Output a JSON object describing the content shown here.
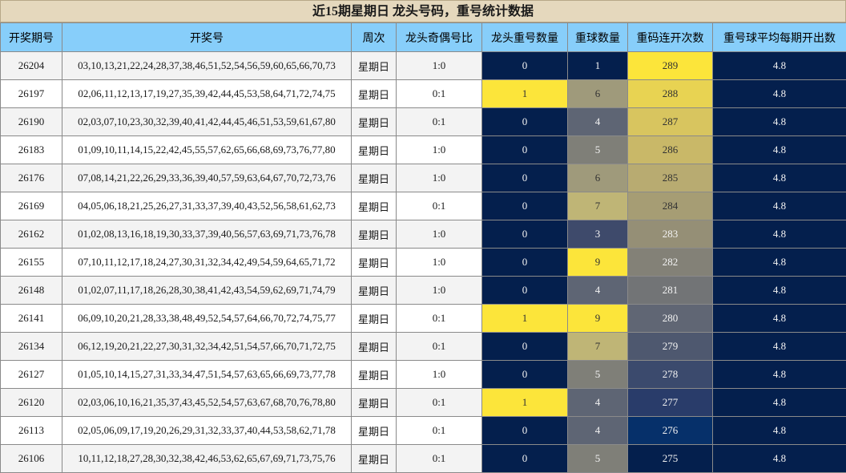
{
  "title": "近15期星期日 龙头号码，重号统计数据",
  "headers": [
    "开奖期号",
    "开奖号",
    "周次",
    "龙头奇偶号比",
    "龙头重号数量",
    "重球数量",
    "重码连开次数",
    "重号球平均每期开出数"
  ],
  "colors": {
    "header_bg": "#87cefa",
    "title_bg": "#e5d8bd",
    "navy": "#041f4d",
    "yellow": "#fce53a"
  },
  "rows": [
    {
      "period": "26204",
      "numbers": "03,10,13,21,22,24,28,37,38,46,51,52,54,56,59,60,65,66,70,73",
      "weekday": "星期日",
      "odd_even": "1:0",
      "head_repeat": "0",
      "repeat_balls": "1",
      "repeat_streak": "289",
      "avg": "4.8",
      "bg_head": "#041f4d",
      "bg_balls": "#041f4d",
      "bg_streak": "#fce53a"
    },
    {
      "period": "26197",
      "numbers": "02,06,11,12,13,17,19,27,35,39,42,44,45,53,58,64,71,72,74,75",
      "weekday": "星期日",
      "odd_even": "0:1",
      "head_repeat": "1",
      "repeat_balls": "6",
      "repeat_streak": "288",
      "avg": "4.8",
      "bg_head": "#fce53a",
      "bg_balls": "#9f9a7b",
      "bg_streak": "#e8d352"
    },
    {
      "period": "26190",
      "numbers": "02,03,07,10,23,30,32,39,40,41,42,44,45,46,51,53,59,61,67,80",
      "weekday": "星期日",
      "odd_even": "0:1",
      "head_repeat": "0",
      "repeat_balls": "4",
      "repeat_streak": "287",
      "avg": "4.8",
      "bg_head": "#041f4d",
      "bg_balls": "#5e6574",
      "bg_streak": "#d8c55f"
    },
    {
      "period": "26183",
      "numbers": "01,09,10,11,14,15,22,42,45,55,57,62,65,66,68,69,73,76,77,80",
      "weekday": "星期日",
      "odd_even": "1:0",
      "head_repeat": "0",
      "repeat_balls": "5",
      "repeat_streak": "286",
      "avg": "4.8",
      "bg_head": "#041f4d",
      "bg_balls": "#7f7f78",
      "bg_streak": "#c9b868"
    },
    {
      "period": "26176",
      "numbers": "07,08,14,21,22,26,29,33,36,39,40,57,59,63,64,67,70,72,73,76",
      "weekday": "星期日",
      "odd_even": "1:0",
      "head_repeat": "0",
      "repeat_balls": "6",
      "repeat_streak": "285",
      "avg": "4.8",
      "bg_head": "#041f4d",
      "bg_balls": "#9f9a7b",
      "bg_streak": "#b8ab71"
    },
    {
      "period": "26169",
      "numbers": "04,05,06,18,21,25,26,27,31,33,37,39,40,43,52,56,58,61,62,73",
      "weekday": "星期日",
      "odd_even": "0:1",
      "head_repeat": "0",
      "repeat_balls": "7",
      "repeat_streak": "284",
      "avg": "4.8",
      "bg_head": "#041f4d",
      "bg_balls": "#bfb576",
      "bg_streak": "#a69d74"
    },
    {
      "period": "26162",
      "numbers": "01,02,08,13,16,18,19,30,33,37,39,40,56,57,63,69,71,73,76,78",
      "weekday": "星期日",
      "odd_even": "1:0",
      "head_repeat": "0",
      "repeat_balls": "3",
      "repeat_streak": "283",
      "avg": "4.8",
      "bg_head": "#041f4d",
      "bg_balls": "#3e4a6b",
      "bg_streak": "#958f76"
    },
    {
      "period": "26155",
      "numbers": "07,10,11,12,17,18,24,27,30,31,32,34,42,49,54,59,64,65,71,72",
      "weekday": "星期日",
      "odd_even": "1:0",
      "head_repeat": "0",
      "repeat_balls": "9",
      "repeat_streak": "282",
      "avg": "4.8",
      "bg_head": "#041f4d",
      "bg_balls": "#fce53a",
      "bg_streak": "#838177"
    },
    {
      "period": "26148",
      "numbers": "01,02,07,11,17,18,26,28,30,38,41,42,43,54,59,62,69,71,74,79",
      "weekday": "星期日",
      "odd_even": "1:0",
      "head_repeat": "0",
      "repeat_balls": "4",
      "repeat_streak": "281",
      "avg": "4.8",
      "bg_head": "#041f4d",
      "bg_balls": "#5e6574",
      "bg_streak": "#727476"
    },
    {
      "period": "26141",
      "numbers": "06,09,10,20,21,28,33,38,48,49,52,54,57,64,66,70,72,74,75,77",
      "weekday": "星期日",
      "odd_even": "0:1",
      "head_repeat": "1",
      "repeat_balls": "9",
      "repeat_streak": "280",
      "avg": "4.8",
      "bg_head": "#fce53a",
      "bg_balls": "#fce53a",
      "bg_streak": "#606674"
    },
    {
      "period": "26134",
      "numbers": "06,12,19,20,21,22,27,30,31,32,34,42,51,54,57,66,70,71,72,75",
      "weekday": "星期日",
      "odd_even": "0:1",
      "head_repeat": "0",
      "repeat_balls": "7",
      "repeat_streak": "279",
      "avg": "4.8",
      "bg_head": "#041f4d",
      "bg_balls": "#bfb576",
      "bg_streak": "#4e586f"
    },
    {
      "period": "26127",
      "numbers": "01,05,10,14,15,27,31,33,34,47,51,54,57,63,65,66,69,73,77,78",
      "weekday": "星期日",
      "odd_even": "1:0",
      "head_repeat": "0",
      "repeat_balls": "5",
      "repeat_streak": "278",
      "avg": "4.8",
      "bg_head": "#041f4d",
      "bg_balls": "#7f7f78",
      "bg_streak": "#3b4a6d"
    },
    {
      "period": "26120",
      "numbers": "02,03,06,10,16,21,35,37,43,45,52,54,57,63,67,68,70,76,78,80",
      "weekday": "星期日",
      "odd_even": "0:1",
      "head_repeat": "1",
      "repeat_balls": "4",
      "repeat_streak": "277",
      "avg": "4.8",
      "bg_head": "#fce53a",
      "bg_balls": "#5e6574",
      "bg_streak": "#293c6a"
    },
    {
      "period": "26113",
      "numbers": "02,05,06,09,17,19,20,26,29,31,32,33,37,40,44,53,58,62,71,78",
      "weekday": "星期日",
      "odd_even": "0:1",
      "head_repeat": "0",
      "repeat_balls": "4",
      "repeat_streak": "276",
      "avg": "4.8",
      "bg_head": "#041f4d",
      "bg_balls": "#5e6574",
      "bg_streak": "#06306a"
    },
    {
      "period": "26106",
      "numbers": "10,11,12,18,27,28,30,32,38,42,46,53,62,65,67,69,71,73,75,76",
      "weekday": "星期日",
      "odd_even": "0:1",
      "head_repeat": "0",
      "repeat_balls": "5",
      "repeat_streak": "275",
      "avg": "4.8",
      "bg_head": "#041f4d",
      "bg_balls": "#7f7f78",
      "bg_streak": "#041f4d"
    }
  ]
}
